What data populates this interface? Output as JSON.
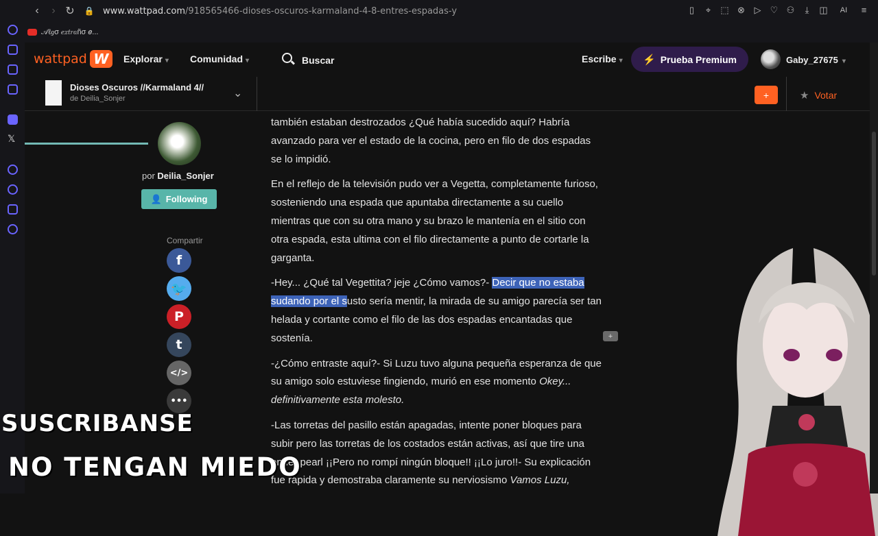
{
  "browser": {
    "url_host": "www.wattpad.com",
    "url_path": "/918565466-dioses-oscuros-karmaland-4-8-entres-espadas-y",
    "bookmark_label": "𝒜ℓ𝑔σ 𝑒𝑥𝑡𝑟𝑎ñσ 𝑒...",
    "ai_label": "AI"
  },
  "nav": {
    "logo_text": "wattpad",
    "logo_mark": "W",
    "explore": "Explorar",
    "community": "Comunidad",
    "search": "Buscar",
    "write": "Escribe",
    "premium": "Prueba Premium",
    "username": "Gaby_27675"
  },
  "story": {
    "title": "Dioses Oscuros //Karmaland 4//",
    "author_line": "de Deilia_Sonjer",
    "add_label": "+",
    "vote_label": "Votar",
    "reading_progress": 0.15
  },
  "author": {
    "by_prefix": "por",
    "name": "Deilia_Sonjer",
    "follow_label": "Following"
  },
  "share": {
    "label": "Compartir",
    "items": [
      {
        "name": "facebook",
        "glyph": "f",
        "color": "#3b5998"
      },
      {
        "name": "twitter",
        "glyph": "🐦",
        "color": "#55acee"
      },
      {
        "name": "pinterest",
        "glyph": "P",
        "color": "#cb2027"
      },
      {
        "name": "tumblr",
        "glyph": "t",
        "color": "#35465c"
      },
      {
        "name": "embed",
        "glyph": "</>",
        "color": "#666666"
      },
      {
        "name": "more",
        "glyph": "•••",
        "color": "#3a3a3a"
      }
    ]
  },
  "content": {
    "p1": "también estaban destrozados ¿Qué había sucedido aquí? Habría avanzado para ver el estado de la cocina, pero en filo de dos espadas se lo impidió.",
    "p2": "En el reflejo de la televisión pudo ver a Vegetta, completamente furioso, sosteniendo una espada que apuntaba directamente a su cuello mientras que con su otra mano y su brazo le mantenía en el sitio con otra espada, esta ultima con el filo directamente a punto de cortarle la garganta.",
    "p3_a": "-Hey... ¿Qué tal Vegettita? jeje ¿Cómo vamos?- ",
    "p3_hl": "Decir que no estaba sudando por el s",
    "p3_b": "usto sería mentir, la mirada de su amigo parecía ser tan helada y cortante como el filo de las dos espadas encantadas que sostenía.",
    "p4_a": "-¿Cómo entraste aquí?- Si Luzu tuvo alguna pequeña esperanza de que su amigo solo estuviese fingiendo, murió en ese momento ",
    "p4_em": "Okey... definitivamente esta molesto.",
    "p5_a": "-Las torretas del pasillo están apagadas, intente poner bloques para subir pero las torretas de los costados están activas, así que tire una ender pearl ¡¡Pero no rompí ningún bloque!! ¡¡Lo juro!!- Su explicación fue rápida y demostraba claramente su nerviosismo ",
    "p5_em": "Vamos Luzu,",
    "comment_icon": "+"
  },
  "overlay": {
    "line1": "SUSCRIBANSE",
    "line2": "NO TENGAN MIEDO"
  }
}
